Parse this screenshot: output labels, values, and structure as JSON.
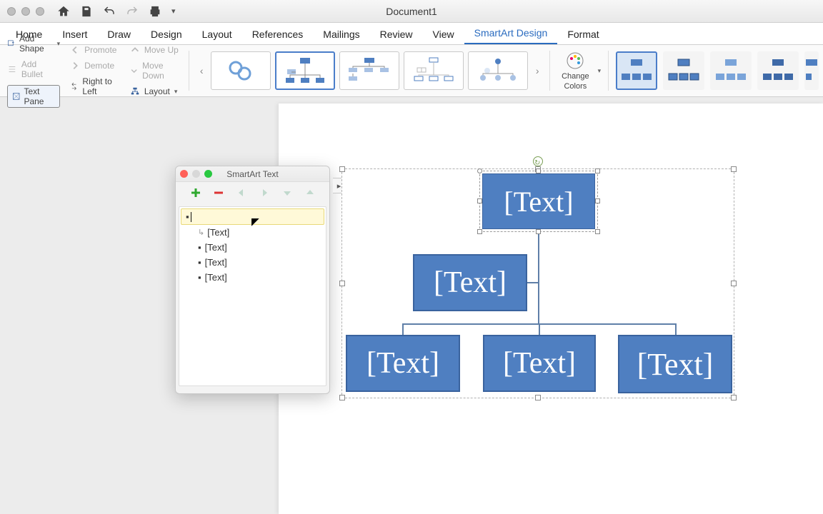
{
  "titlebar": {
    "document_title": "Document1"
  },
  "ribbon_tabs": {
    "items": [
      "Home",
      "Insert",
      "Draw",
      "Design",
      "Layout",
      "References",
      "Mailings",
      "Review",
      "View",
      "SmartArt Design",
      "Format"
    ],
    "active_index": 9
  },
  "ribbon": {
    "add_shape": "Add Shape",
    "add_bullet": "Add Bullet",
    "text_pane": "Text Pane",
    "promote": "Promote",
    "demote": "Demote",
    "right_to_left": "Right to Left",
    "move_up": "Move Up",
    "move_down": "Move Down",
    "layout": "Layout",
    "change_colors_line1": "Change",
    "change_colors_line2": "Colors"
  },
  "smartart_panel": {
    "title": "SmartArt Text",
    "rows": [
      {
        "level": 0,
        "text": "",
        "editing": true
      },
      {
        "level": 1,
        "text": "[Text]",
        "assistant": true
      },
      {
        "level": 1,
        "text": "[Text]"
      },
      {
        "level": 1,
        "text": "[Text]"
      },
      {
        "level": 1,
        "text": "[Text]"
      }
    ]
  },
  "smartart_canvas": {
    "nodes": {
      "top": "[Text]",
      "assistant": "[Text]",
      "child1": "[Text]",
      "child2": "[Text]",
      "child3": "[Text]"
    }
  },
  "colors": {
    "node_fill": "#4f7fc1",
    "node_border": "#3a639e",
    "selection": "#4a7dc9"
  }
}
